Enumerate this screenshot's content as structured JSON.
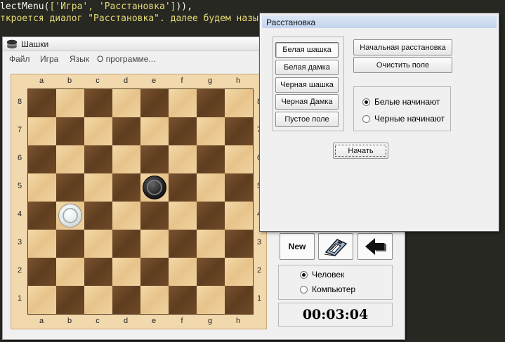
{
  "editor": {
    "line1_fn": "lectMenu(",
    "line1_args": "['Игра', 'Расстановка']",
    "line1_end": ")),",
    "line2": "ткроется диалог \"Расстановка\". далее будем назыв"
  },
  "window": {
    "title": "Шашки",
    "menu": [
      "Файл",
      "Игра",
      "Язык",
      "О программе..."
    ]
  },
  "board": {
    "files": [
      "a",
      "b",
      "c",
      "d",
      "e",
      "f",
      "g",
      "h"
    ],
    "ranks": [
      "8",
      "7",
      "6",
      "5",
      "4",
      "3",
      "2",
      "1"
    ],
    "pieces": [
      {
        "square": "e5",
        "color": "black",
        "type": "man"
      },
      {
        "square": "b4",
        "color": "white",
        "type": "man"
      }
    ],
    "colors": {
      "light": "#f0d3a0",
      "dark": "#6f4a28"
    }
  },
  "controls": {
    "new_label": "New",
    "save_icon": "floppy-disk-icon",
    "back_icon": "arrow-left-icon",
    "players": [
      {
        "label": "Человек",
        "selected": true
      },
      {
        "label": "Компьютер",
        "selected": false
      }
    ],
    "timer": "00:03:04"
  },
  "dialog": {
    "title": "Расстановка",
    "piece_buttons": [
      "Белая шашка",
      "Белая дамка",
      "Черная шашка",
      "Черная Дамка",
      "Пустое поле"
    ],
    "selected_piece": 0,
    "initial_btn": "Начальная расстановка",
    "clear_btn": "Очистить поле",
    "first_move": [
      {
        "label": "Белые начинают",
        "selected": true
      },
      {
        "label": "Черные начинают",
        "selected": false
      }
    ],
    "start_btn": "Начать"
  }
}
